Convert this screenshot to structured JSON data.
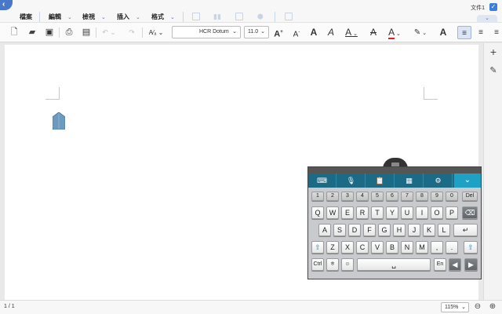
{
  "menubar": {
    "back_icon": "back-arrow-icon",
    "items": [
      {
        "label": "檔案"
      },
      {
        "label": "編輯"
      },
      {
        "label": "檢視"
      },
      {
        "label": "插入"
      },
      {
        "label": "格式"
      }
    ],
    "file_name": "文件1",
    "check_icon": "checkbox-checked-icon",
    "collapse_icon": "chevron-down-icon"
  },
  "toolbar": {
    "font_name": "HCR Dotum",
    "font_size": "11.0"
  },
  "status": {
    "page_count": "1 / 1",
    "zoom": "115%"
  },
  "keyboard": {
    "num_row": [
      "1",
      "2",
      "3",
      "4",
      "5",
      "6",
      "7",
      "8",
      "9",
      "0",
      "Del"
    ],
    "row1": [
      "Q",
      "W",
      "E",
      "R",
      "T",
      "Y",
      "U",
      "I",
      "O",
      "P"
    ],
    "row2": [
      "A",
      "S",
      "D",
      "F",
      "G",
      "H",
      "J",
      "K",
      "L"
    ],
    "row3": [
      "Z",
      "X",
      "C",
      "V",
      "B",
      "N",
      "M",
      ",",
      "."
    ],
    "ctrl": "Ctrl",
    "lang": "En"
  },
  "colors": {
    "accent": "#4a78c8",
    "keyboard_bar": "#1b6b86",
    "keyboard_hide": "#1ea1c4",
    "font_color_underline": "#e02020"
  }
}
